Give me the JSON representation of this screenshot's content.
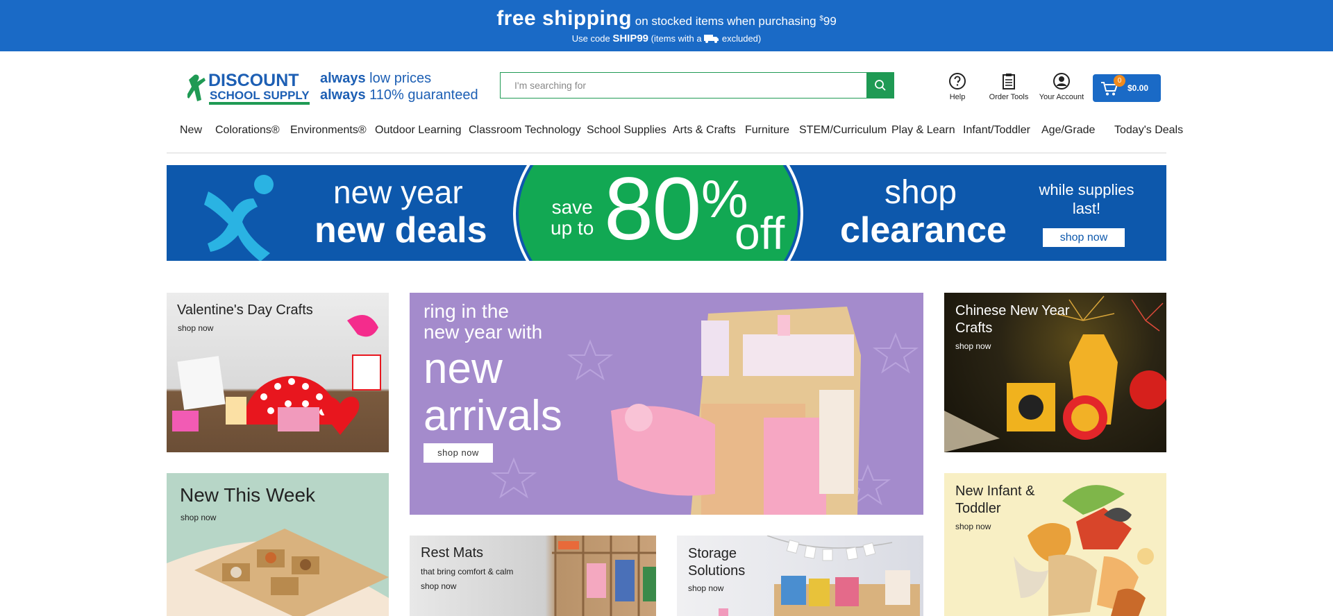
{
  "promo": {
    "headline": "free shipping",
    "subline": "on stocked items when purchasing",
    "price_symbol": "$",
    "price": "99",
    "use_code": "Use code",
    "code": "SHIP99",
    "items_with": "(items with a",
    "excluded": "excluded)"
  },
  "header": {
    "logo_line1": "DISCOUNT",
    "logo_line2": "SCHOOL SUPPLY",
    "tagline_1_bold": "always",
    "tagline_1_rest": " low prices",
    "tagline_2_bold": "always",
    "tagline_2_rest": " 110% guaranteed",
    "search_placeholder": "I'm searching for",
    "tools": [
      {
        "label": "Help",
        "icon": "help-icon"
      },
      {
        "label": "Order Tools",
        "icon": "clipboard-icon"
      },
      {
        "label": "Your Account",
        "icon": "account-icon"
      }
    ],
    "cart": {
      "count": "0",
      "total": "$0.00",
      "icon": "cart-icon"
    }
  },
  "nav": {
    "items": [
      "New",
      "Colorations®",
      "Environments®",
      "Outdoor Learning",
      "Classroom Technology",
      "School Supplies",
      "Arts & Crafts",
      "Furniture",
      "STEM/Curriculum",
      "Play & Learn",
      "Infant/Toddler",
      "Age/Grade",
      "Today's Deals"
    ]
  },
  "hero": {
    "line1": "new year",
    "line2": "new deals",
    "save1": "save",
    "save2": "up to",
    "big": "80",
    "pct": "%",
    "off": "off",
    "shop": "shop",
    "clearance": "clearance",
    "while": "while supplies last!",
    "button": "shop now"
  },
  "tiles": {
    "valentines": {
      "title": "Valentine's Day Crafts",
      "shop": "shop now"
    },
    "center": {
      "line1": "ring in the",
      "line2": "new year with",
      "big1": "new",
      "big2": "arrivals",
      "button": "shop now"
    },
    "chinese": {
      "title": "Chinese New Year Crafts",
      "shop": "shop now"
    },
    "newweek": {
      "title": "New This Week",
      "shop": "shop now"
    },
    "restmats": {
      "title": "Rest Mats",
      "sub": "that bring comfort & calm",
      "shop": "shop now"
    },
    "storage": {
      "title": "Storage Solutions",
      "shop": "shop now"
    },
    "infant": {
      "title": "New Infant & Toddler",
      "shop": "shop now"
    }
  },
  "colors": {
    "promo_blue": "#1a6ac6",
    "brand_green": "#1f9a54",
    "hero_blue": "#0d58ac",
    "center_purple": "#a48bcc"
  }
}
